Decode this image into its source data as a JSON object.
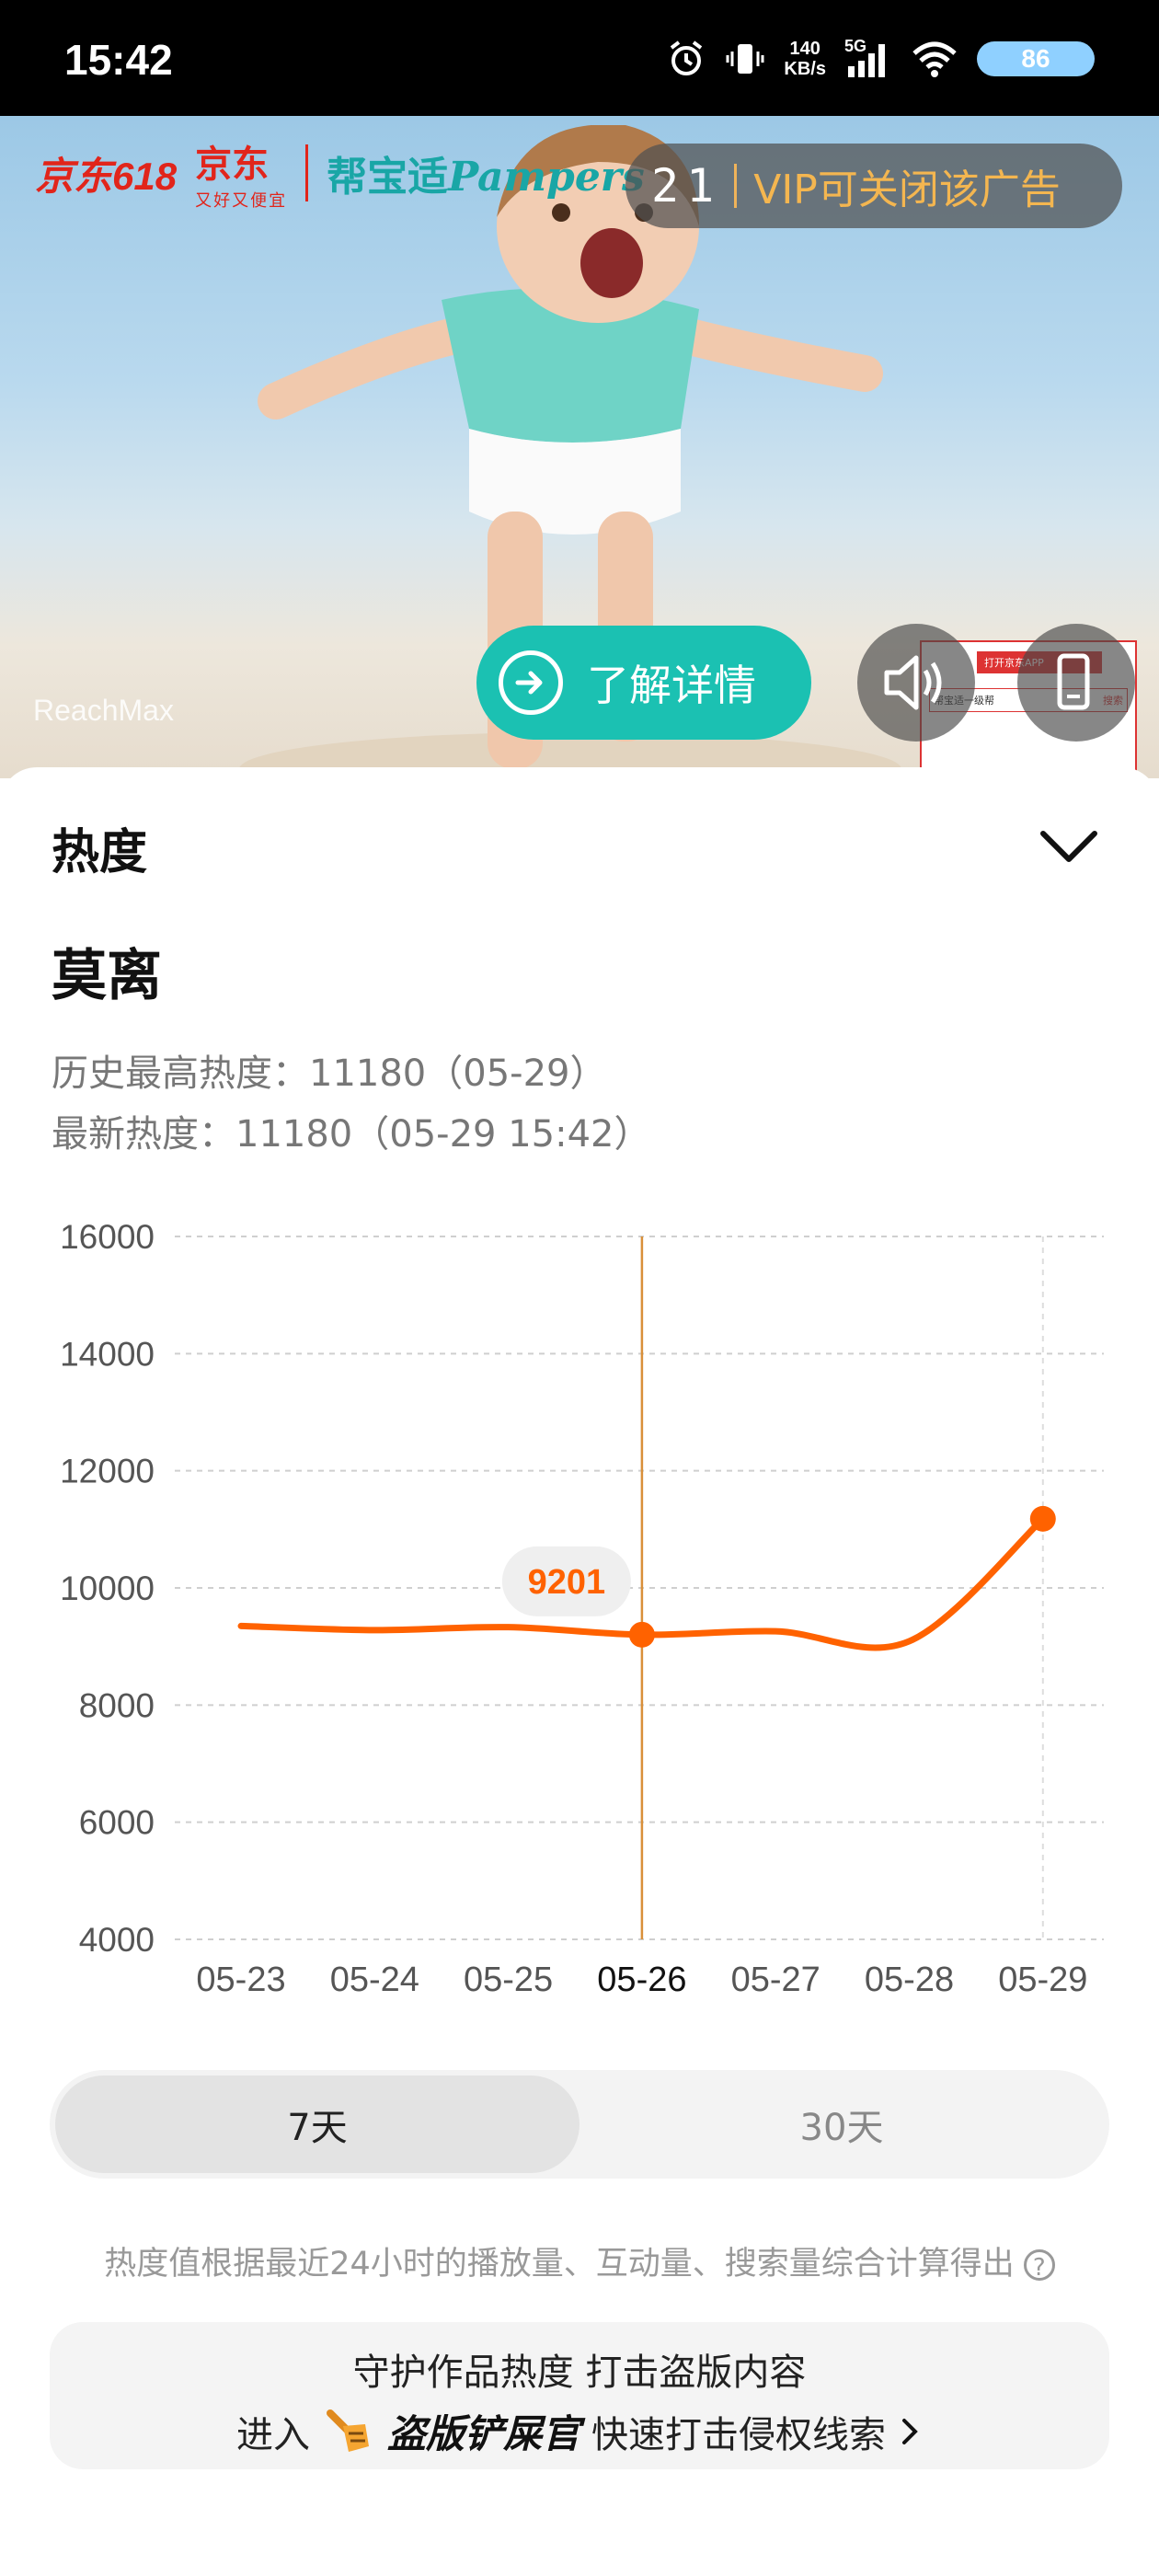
{
  "status_bar": {
    "time": "15:42",
    "net_speed_value": "140",
    "net_speed_unit": "KB/s",
    "network": "5G",
    "battery": "86",
    "icons": [
      "alarm-icon",
      "vibrate-icon",
      "signal-icon",
      "wifi-icon"
    ]
  },
  "ad": {
    "brand_jd618": "京东618",
    "brand_jd": "京东",
    "brand_jd_slogan": "又好又便宜",
    "brand_pampers_cn": "帮宝适",
    "brand_pampers_en": "Pampers",
    "countdown": "21",
    "vip_text": "VIP可关闭该广告",
    "cta_label": "了解详情",
    "watermark": "ReachMax",
    "thumb_top": "打开京东APP",
    "thumb_search": "帮宝适一级帮",
    "thumb_btn": "搜索"
  },
  "sheet": {
    "title": "热度",
    "subject": "莫离",
    "history_max": "历史最高热度：11180（05-29）",
    "latest": "最新热度：11180（05-29 15:42）"
  },
  "chart_data": {
    "type": "line",
    "x": [
      "05-23",
      "05-24",
      "05-25",
      "05-26",
      "05-27",
      "05-28",
      "05-29"
    ],
    "series": [
      {
        "values": [
          9350,
          9280,
          9330,
          9201,
          9260,
          9090,
          11180
        ]
      }
    ],
    "ylim": [
      4000,
      16000
    ],
    "yticks": [
      16000,
      14000,
      12000,
      10000,
      8000,
      6000,
      4000
    ],
    "selected_index": 3,
    "tooltip": "9201",
    "grid": true,
    "colors": {
      "line": "#ff6200",
      "cursor": "#d9903a"
    }
  },
  "tabs": {
    "active": "7天",
    "inactive": "30天"
  },
  "note": "热度值根据最近24小时的播放量、互动量、搜索量综合计算得出",
  "promo": {
    "line1": "守护作品热度 打击盗版内容",
    "enter": "进入",
    "brand": "盗版铲屎官",
    "action": "快速打击侵权线索"
  }
}
